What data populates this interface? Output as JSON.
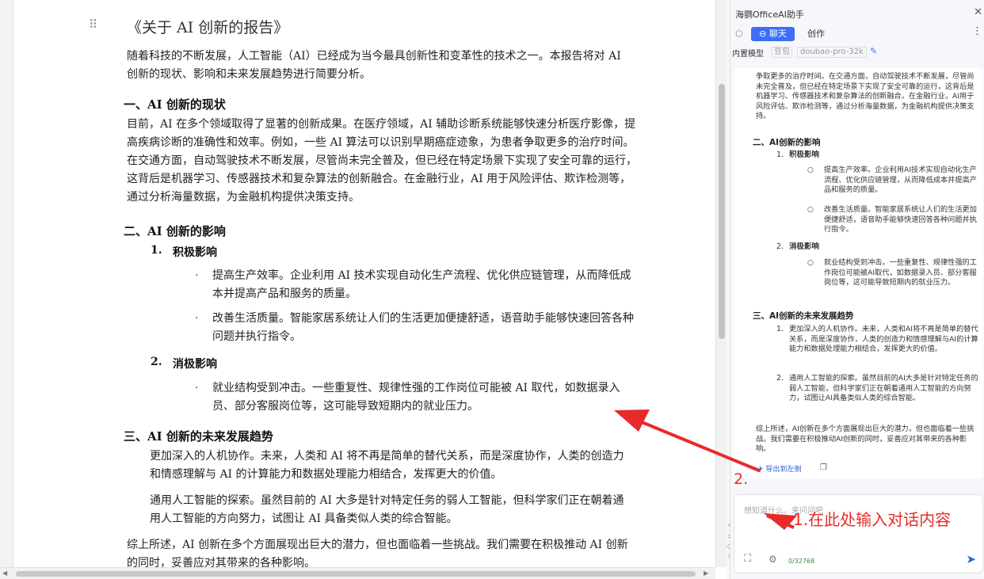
{
  "document": {
    "title": "《关于 AI 创新的报告》",
    "intro": "随着科技的不断发展，人工智能（AI）已经成为当今最具创新性和变革性的技术之一。本报告将对 AI 创新的现状、影响和未来发展趋势进行简要分析。",
    "s1_heading": "一、AI 创新的现状",
    "s1_body": "目前，AI 在多个领域取得了显著的创新成果。在医疗领域，AI 辅助诊断系统能够快速分析医疗影像，提高疾病诊断的准确性和效率。例如，一些 AI 算法可以识别早期癌症迹象，为患者争取更多的治疗时间。在交通方面，自动驾驶技术不断发展，尽管尚未完全普及，但已经在特定场景下实现了安全可靠的运行，这背后是机器学习、传感器技术和复杂算法的创新融合。在金融行业，AI 用于风险评估、欺诈检测等，通过分析海量数据，为金融机构提供决策支持。",
    "s2_heading": "二、AI 创新的影响",
    "s2_sub1_num": "1.",
    "s2_sub1": "积极影响",
    "s2_b1": "提高生产效率。企业利用 AI 技术实现自动化生产流程、优化供应链管理，从而降低成本并提高产品和服务的质量。",
    "s2_b2": "改善生活质量。智能家居系统让人们的生活更加便捷舒适，语音助手能够快速回答各种问题并执行指令。",
    "s2_sub2_num": "2.",
    "s2_sub2": "消极影响",
    "s2_b3": "就业结构受到冲击。一些重复性、规律性强的工作岗位可能被 AI 取代，如数据录入员、部分客服岗位等，这可能导致短期内的就业压力。",
    "s3_heading": "三、AI 创新的未来发展趋势",
    "s3_p1": "更加深入的人机协作。未来，人类和 AI 将不再是简单的替代关系，而是深度协作，人类的创造力和情感理解与 AI 的计算能力和数据处理能力相结合，发挥更大的价值。",
    "s3_p2": "通用人工智能的探索。虽然目前的 AI 大多是针对特定任务的弱人工智能，但科学家们正在朝着通用人工智能的方向努力，试图让 AI 具备类似人类的综合智能。",
    "conclusion": "综上所述，AI 创新在多个方面展现出巨大的潜力，但也面临着一些挑战。我们需要在积极推动 AI 创新的同时，妥善应对其带来的各种影响。",
    "bullet_glyph": "·"
  },
  "panel": {
    "title": "海鹦OfficeAI助手",
    "tab_chat": "聊天",
    "tab_create": "创作",
    "model_label": "内置模型",
    "model_provider": "豆包",
    "model_name": "doubao-pro-32k",
    "reply": {
      "p0": "争取更多的治疗时间。在交通方面，自动驾驶技术不断发展，尽管尚未完全普及，但已经在特定场景下实现了安全可靠的运行，这背后是机器学习、传感器技术和复杂算法的创新融合。在金融行业，AI用于风险评估、欺诈检测等，通过分析海量数据，为金融机构提供决策支持。",
      "h2": "二、AI创新的影响",
      "n1": "1.",
      "n1_label": "积极影响",
      "c1": "提高生产效率。企业利用AI技术实现自动化生产流程、优化供应链管理，从而降低成本并提高产品和服务的质量。",
      "c2": "改善生活质量。智能家居系统让人们的生活更加便捷舒适，语音助手能够快速回答各种问题并执行指令。",
      "n2": "2.",
      "n2_label": "消极影响",
      "c3": "就业结构受到冲击。一些重复性、规律性强的工作岗位可能被AI取代，如数据录入员、部分客服岗位等，这可能导致短期内的就业压力。",
      "h3": "三、AI创新的未来发展趋势",
      "t1_num": "1.",
      "t1": "更加深入的人机协作。未来，人类和AI将不再是简单的替代关系，而是深度协作，人类的创造力和情感理解与AI的计算能力和数据处理能力相结合，发挥更大的价值。",
      "t2_num": "2.",
      "t2": "通用人工智能的探索。虽然目前的AI大多是针对特定任务的弱人工智能，但科学家们正在朝着通用人工智能的方向努力，试图让AI具备类似人类的综合智能。",
      "conclusion": "综上所述，AI创新在多个方面展现出巨大的潜力，但也面临着一些挑战。我们需要在积极推动AI创新的同时，妥善应对其带来的各种影响。",
      "circle_glyph": "○"
    },
    "export_label": "导出到左侧",
    "input_placeholder": "想知道什么，来问问吧",
    "char_count": "0/32768"
  },
  "annotations": {
    "label1": "1.在此处输入对话内容",
    "label2": "2.",
    "color": "#e82a2a"
  },
  "icons": {
    "drag": "drag-handle-icon",
    "close": "close-icon",
    "cube": "cube-icon",
    "chat": "chat-bubble-icon",
    "more": "more-vertical-icon",
    "edit": "edit-pencil-icon",
    "export": "export-arrow-icon",
    "copy": "copy-icon",
    "capture": "screenshot-capture-icon",
    "settings": "gear-icon",
    "send": "send-arrow-icon"
  },
  "colors": {
    "accent": "#3d6ef5",
    "send": "#2f62e8",
    "char_count": "#3a8b3a",
    "panel_bg": "#f6f7fb"
  }
}
